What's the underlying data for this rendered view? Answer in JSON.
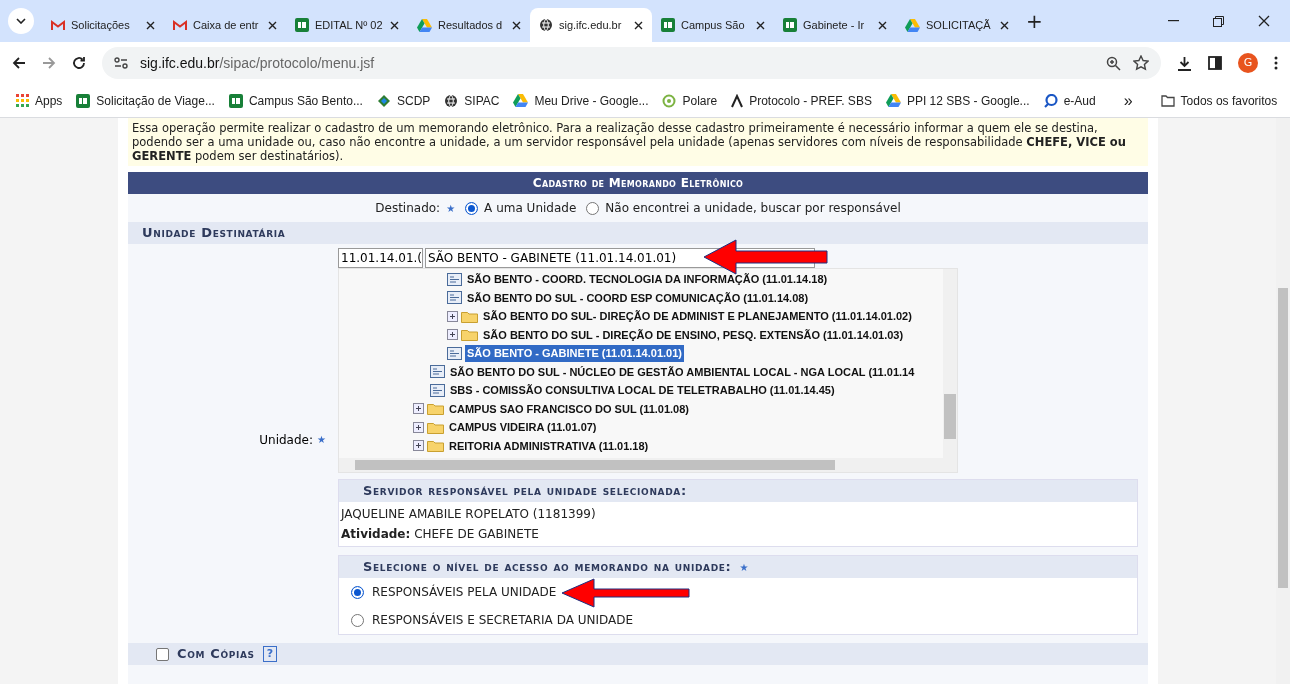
{
  "browser": {
    "tabs": [
      {
        "label": "Solicitações",
        "kind": "gmail",
        "selected": false
      },
      {
        "label": "Caixa de entr",
        "kind": "gmail",
        "selected": false
      },
      {
        "label": "EDITAL Nº 02",
        "kind": "sheet",
        "selected": false
      },
      {
        "label": "Resultados d",
        "kind": "drive",
        "selected": false
      },
      {
        "label": "sig.ifc.edu.br",
        "kind": "globe",
        "selected": true
      },
      {
        "label": "Campus São",
        "kind": "sheet",
        "selected": false
      },
      {
        "label": "Gabinete - Ir",
        "kind": "sheet",
        "selected": false
      },
      {
        "label": "SOLICITAÇÃ",
        "kind": "drive",
        "selected": false
      }
    ],
    "new_tab": "+",
    "address": {
      "host": "sig.ifc.edu.br",
      "path": "/sipac/protocolo/menu.jsf"
    },
    "profile": "G",
    "bookmarks": [
      {
        "label": "Apps",
        "kind": "apps"
      },
      {
        "label": "Solicitação de Viage...",
        "kind": "sheet"
      },
      {
        "label": "Campus São Bento...",
        "kind": "sheet"
      },
      {
        "label": "SCDP",
        "kind": "scdp"
      },
      {
        "label": "SIPAC",
        "kind": "globe"
      },
      {
        "label": "Meu Drive - Google...",
        "kind": "drive"
      },
      {
        "label": "Polare",
        "kind": "polare"
      },
      {
        "label": "Protocolo - PREF. SBS",
        "kind": "lambda"
      },
      {
        "label": "PPI 12 SBS - Google...",
        "kind": "drive"
      },
      {
        "label": "e-Aud",
        "kind": "eaud"
      }
    ],
    "more": "»",
    "all_bookmarks": "Todos os favoritos"
  },
  "notice": "Essa operação permite realizar o cadastro de um memorando eletrônico. Para a realização desse cadastro primeiramente é necessário informar a quem ele se destina, podendo ser a uma unidade ou, caso não encontre a unidade, a um servidor responsável pela unidade (apenas servidores com níveis de responsabilidade **CHEFE, VICE ou GERENTE** podem ser destinatários).",
  "form": {
    "title": "Cadastro de Memorando Eletrônico",
    "required_mark": "★",
    "destinado": {
      "label": "Destinado:",
      "options": [
        {
          "label": "A uma Unidade",
          "selected": true
        },
        {
          "label": "Não encontrei a unidade, buscar por responsável",
          "selected": false
        }
      ]
    },
    "section": "Unidade Destinatária",
    "unidade_label": "Unidade:",
    "code_field": "11.01.14.01.(",
    "unit_select": "SÃO BENTO - GABINETE (11.01.14.01.01)",
    "tree": [
      {
        "children": [
          {
            "children": [
              {
                "label": "SÃO BENTO - COORD. TECNOLOGIA DA INFORMAÇÃO (11.01.14.18)",
                "kind": "unit",
                "selected": false
              },
              {
                "label": "SÃO BENTO DO SUL - COORD ESP COMUNICAÇÃO (11.01.14.08)",
                "kind": "unit",
                "selected": false
              },
              {
                "label": "SÃO BENTO DO SUL- DIREÇÃO DE ADMINIST E PLANEJAMENTO (11.01.14.01.02)",
                "kind": "folder",
                "expanded": false,
                "selected": false
              },
              {
                "label": "SÃO BENTO DO SUL - DIREÇÃO DE ENSINO, PESQ. EXTENSÃO (11.01.14.01.03)",
                "kind": "folder",
                "expanded": false,
                "selected": false
              },
              {
                "label": "SÃO BENTO - GABINETE (11.01.14.01.01)",
                "kind": "unit",
                "selected": true
              }
            ]
          },
          {
            "label": "SÃO BENTO DO SUL - NÚCLEO DE GESTÃO AMBIENTAL LOCAL - NGA LOCAL (11.01.14",
            "kind": "unit",
            "selected": false
          },
          {
            "label": "SBS - COMISSÃO CONSULTIVA LOCAL DE TELETRABALHO (11.01.14.45)",
            "kind": "unit",
            "selected": false
          }
        ]
      },
      {
        "label": "CAMPUS SAO FRANCISCO DO SUL (11.01.08)",
        "kind": "folder",
        "expanded": false,
        "selected": false
      },
      {
        "label": "CAMPUS VIDEIRA (11.01.07)",
        "kind": "folder",
        "expanded": false,
        "selected": false
      },
      {
        "label": "REITORIA ADMINISTRATIVA (11.01.18)",
        "kind": "folder",
        "expanded": false,
        "selected": false
      }
    ],
    "servidor": {
      "title": "Servidor responsável pela unidade selecionada:",
      "name": "JAQUELINE AMABILE ROPELATO (1181399)",
      "activity_label": "Atividade:",
      "activity": "CHEFE DE GABINETE"
    },
    "acesso": {
      "title": "Selecione o nível de acesso ao memorando na unidade:",
      "options": [
        {
          "label": "RESPONSÁVEIS PELA UNIDADE",
          "selected": true
        },
        {
          "label": "RESPONSÁVEIS E SECRETARIA DA UNIDADE",
          "selected": false
        }
      ]
    },
    "copias": {
      "label": "Com Cópias",
      "checked": false,
      "help": "?"
    }
  }
}
